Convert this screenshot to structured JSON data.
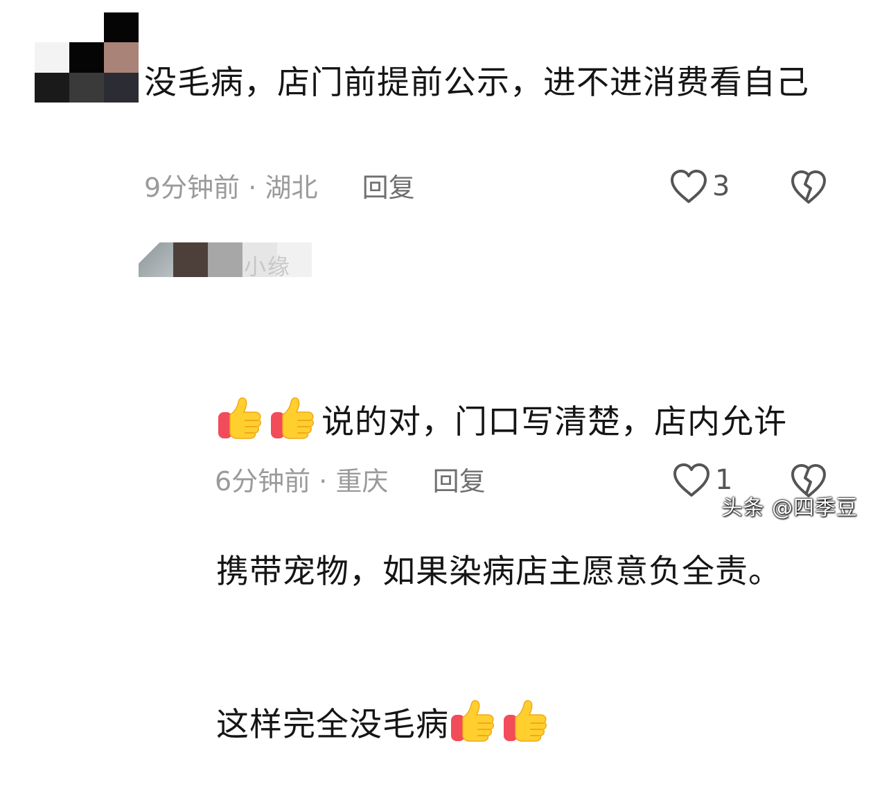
{
  "comments": [
    {
      "text": "没毛病，店门前提前公示，进不进消费看自己",
      "time": "9分钟前",
      "separator": "·",
      "location": "湖北",
      "reply_label": "回复",
      "likes": "3"
    },
    {
      "username_fragment": "小缘",
      "text_line1": "说的对，门口写清楚，店内允许",
      "text_line2": "携带宠物，如果染病店主愿意负全责。",
      "text_line3": "这样完全没毛病",
      "emoji": "thumbs-up",
      "time": "6分钟前",
      "separator": "·",
      "location": "重庆",
      "reply_label": "回复",
      "likes": "1"
    }
  ],
  "icons": {
    "like": "heart-outline-icon",
    "dislike": "broken-heart-icon",
    "emoji": "thumbs-up-emoji"
  },
  "colors": {
    "text": "#151515",
    "meta": "#9a9a9a",
    "icon": "#555555",
    "emoji_yellow": "#ffcf2e",
    "emoji_cuff": "#f24b5a"
  },
  "watermark": "头条 @四季豆"
}
